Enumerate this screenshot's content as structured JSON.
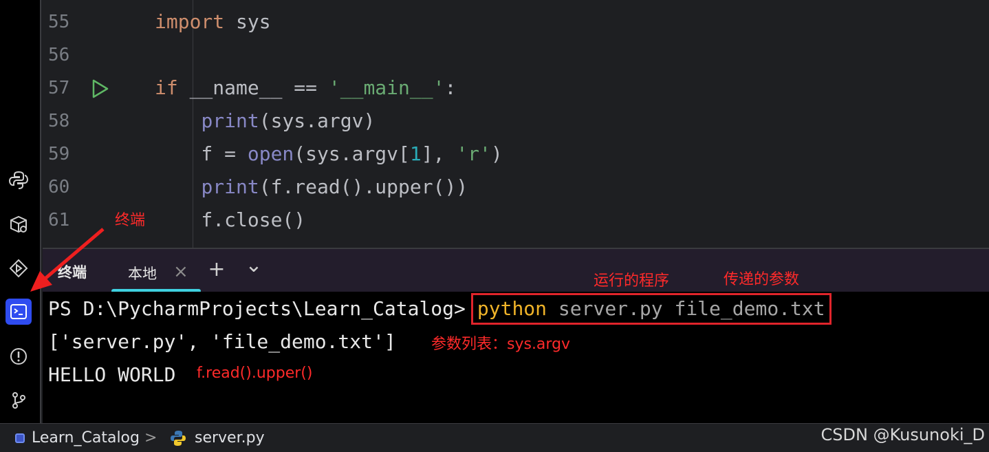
{
  "editor": {
    "lines": [
      {
        "number": "55",
        "tokens": [
          [
            "kw",
            "import"
          ],
          [
            "plain",
            " sys"
          ]
        ]
      },
      {
        "number": "56",
        "tokens": []
      },
      {
        "number": "57",
        "tokens": [
          [
            "kw",
            "if"
          ],
          [
            "plain",
            " __name__ == "
          ],
          [
            "str",
            "'__main__'"
          ],
          [
            "plain",
            ":"
          ]
        ],
        "run_gutter": true
      },
      {
        "number": "58",
        "tokens": [
          [
            "plain",
            "    "
          ],
          [
            "fn",
            "print"
          ],
          [
            "plain",
            "(sys.argv)"
          ]
        ]
      },
      {
        "number": "59",
        "tokens": [
          [
            "plain",
            "    f = "
          ],
          [
            "fn",
            "open"
          ],
          [
            "plain",
            "(sys.argv["
          ],
          [
            "num",
            "1"
          ],
          [
            "plain",
            "], "
          ],
          [
            "str",
            "'r'"
          ],
          [
            "plain",
            ")"
          ]
        ]
      },
      {
        "number": "60",
        "tokens": [
          [
            "plain",
            "    "
          ],
          [
            "fn",
            "print"
          ],
          [
            "plain",
            "(f.read().upper())"
          ]
        ]
      },
      {
        "number": "61",
        "tokens": [
          [
            "plain",
            "    f.close()"
          ]
        ]
      }
    ]
  },
  "toolwindow": {
    "title": "终端",
    "tab_label": "本地",
    "close_glyph": "×",
    "add_glyph": "+",
    "dropdown_glyph": "⌄"
  },
  "terminal": {
    "prompt": "PS D:\\PycharmProjects\\Learn_Catalog>",
    "command_program": "python",
    "command_args": " server.py file_demo.txt",
    "output_line1": "['server.py', 'file_demo.txt']",
    "output_line2": "HELLO WORLD"
  },
  "annotations": {
    "terminal_label": "终端",
    "program_label": "运行的程序",
    "args_label": "传递的参数",
    "argv_label": "参数列表：sys.argv",
    "upper_label": "f.read().upper()",
    "color": "#ff2a2a"
  },
  "statusbar": {
    "project": "Learn_Catalog",
    "separator": ">",
    "file": "server.py"
  },
  "watermark": "CSDN @Kusunoki_D",
  "colors": {
    "keyword": "#cf8e6d",
    "string": "#6aab73",
    "builtin": "#8888c6",
    "number": "#2aacb8",
    "active_tool": "#2f4cf0",
    "highlight_box": "#e0242b"
  }
}
